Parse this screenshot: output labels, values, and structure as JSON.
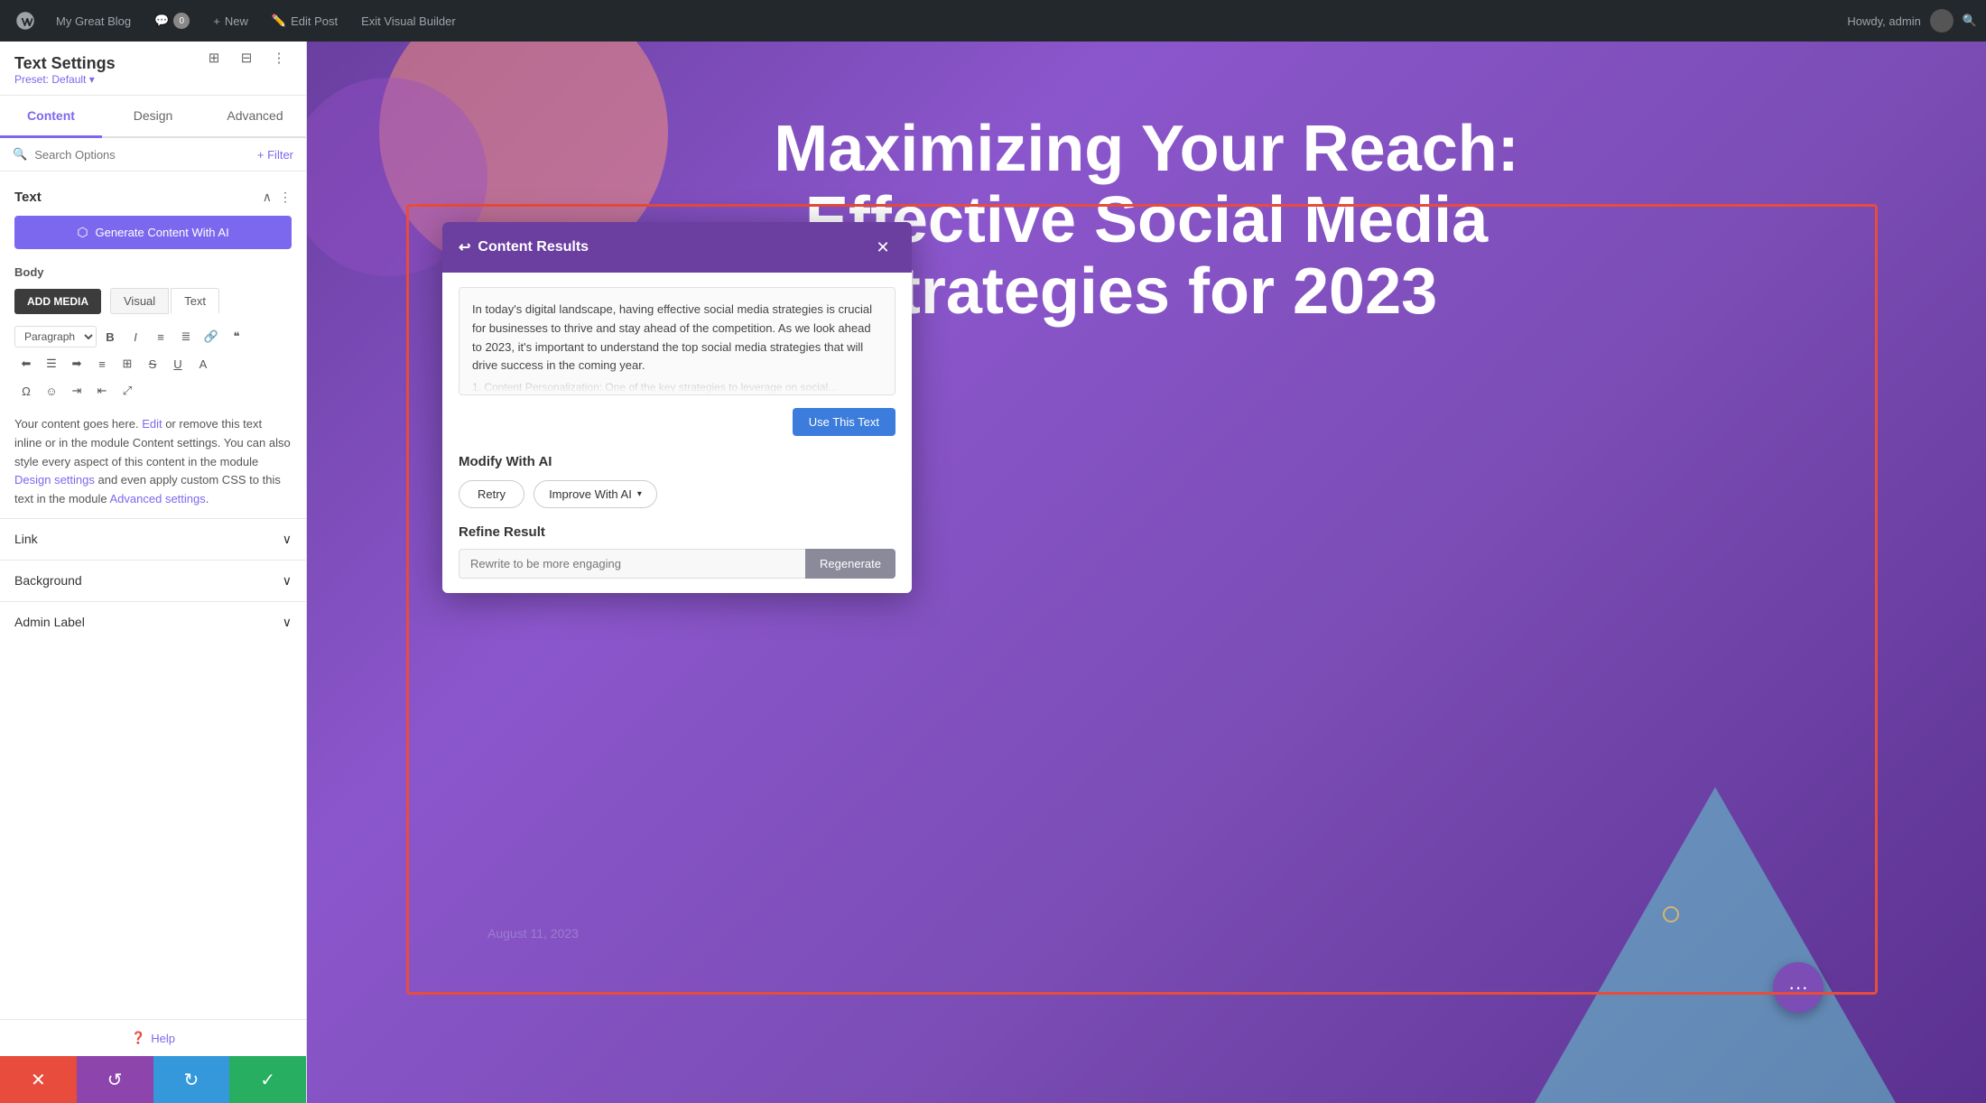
{
  "adminBar": {
    "wp_logo_label": "WordPress",
    "site_name": "My Great Blog",
    "comments_label": "0",
    "new_label": "New",
    "edit_post_label": "Edit Post",
    "exit_builder_label": "Exit Visual Builder",
    "howdy_label": "Howdy, admin"
  },
  "sidebar": {
    "title": "Text Settings",
    "preset_label": "Preset: Default ▾",
    "tabs": [
      {
        "id": "content",
        "label": "Content"
      },
      {
        "id": "design",
        "label": "Design"
      },
      {
        "id": "advanced",
        "label": "Advanced"
      }
    ],
    "active_tab": "content",
    "search_placeholder": "Search Options",
    "filter_label": "+ Filter",
    "text_section_label": "Text",
    "ai_button_label": "Generate Content With AI",
    "body_label": "Body",
    "add_media_label": "ADD MEDIA",
    "visual_tab_label": "Visual",
    "text_tab_label": "Text",
    "editor_placeholder": "Paragraph",
    "body_text": "Your content goes here. Edit or remove this text inline or in the module Content settings. You can also style every aspect of this content in the module Design settings and even apply custom CSS to this text in the module Advanced settings.",
    "link_label": "Link",
    "background_label": "Background",
    "admin_label": "Admin Label",
    "help_label": "Help"
  },
  "actions": {
    "cancel_icon": "✕",
    "undo_icon": "↺",
    "redo_icon": "↻",
    "save_icon": "✓"
  },
  "modal": {
    "title": "Content Results",
    "back_icon": "↩",
    "close_icon": "✕",
    "preview_text": "In today's digital landscape, having effective social media strategies is crucial for businesses to thrive and stay ahead of the competition. As we look ahead to 2023, it's important to understand the top social media strategies that will drive success in the coming year.",
    "preview_item": "1. Content Personalization: One of the key strategies to leverage on social...",
    "use_text_label": "Use This Text",
    "modify_section_label": "Modify With AI",
    "retry_label": "Retry",
    "improve_label": "Improve With AI",
    "improve_dropdown_icon": "▾",
    "refine_section_label": "Refine Result",
    "refine_placeholder": "Rewrite to be more engaging",
    "regenerate_label": "Regenerate"
  },
  "page": {
    "heading_line1": "Maximizing Your Reach:",
    "heading_line2": "Effective Social Media",
    "heading_line3": "Strategies for 2023",
    "date_label": "August 11, 2023",
    "fab_icon": "···"
  }
}
